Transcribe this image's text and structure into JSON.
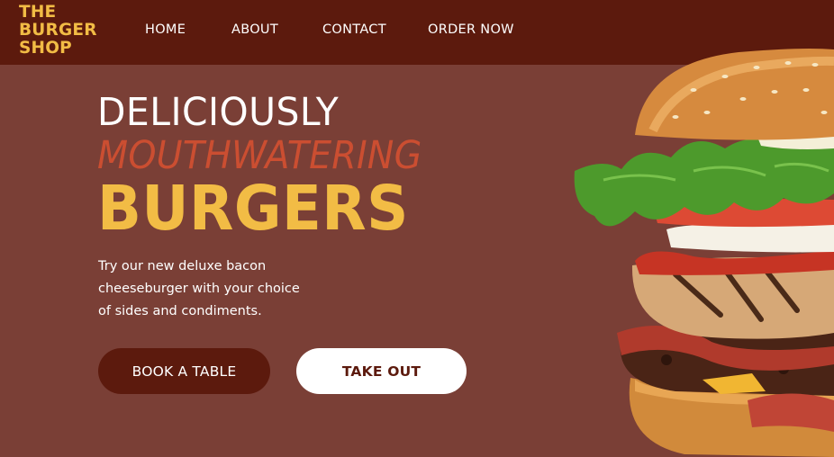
{
  "nav": {
    "logo_lines": [
      "THE",
      "BURGER",
      "SHOP"
    ],
    "links": [
      "HOME",
      "ABOUT",
      "CONTACT",
      "ORDER NOW"
    ]
  },
  "hero": {
    "line1": "DELICIOUSLY",
    "line2": "MOUTHWATERING",
    "line3": "BURGERS",
    "tagline_lines": [
      "Try our new deluxe bacon",
      "cheeseburger with your choice",
      "of sides and condiments."
    ],
    "buttons": {
      "book": "BOOK A TABLE",
      "takeout": "TAKE OUT"
    }
  },
  "colors": {
    "background": "#7a3f36",
    "navbar": "#5c1a0d",
    "accent_yellow": "#f2bc45",
    "accent_red": "#cb4e31"
  }
}
